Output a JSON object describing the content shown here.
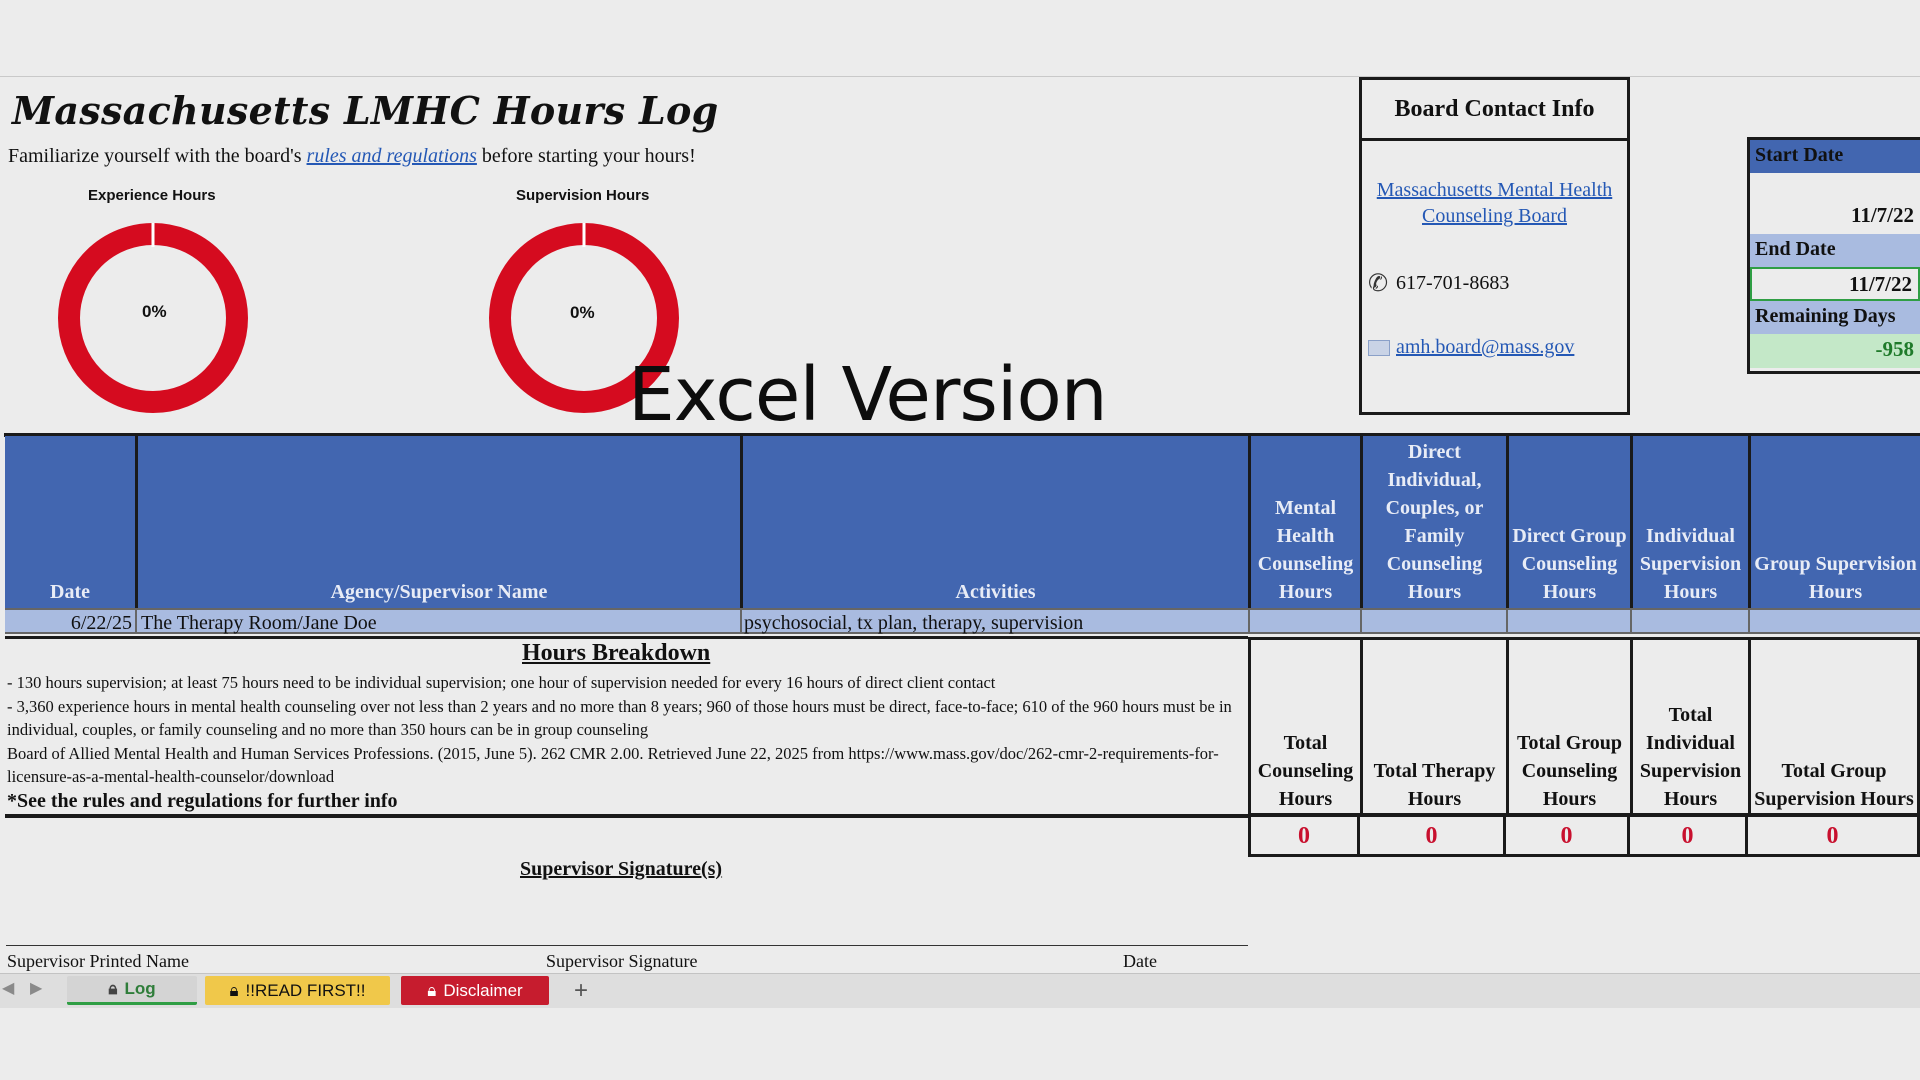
{
  "header": {
    "title": "Massachusetts LMHC Hours Log",
    "subtitle_before": "Familiarize yourself with the board's ",
    "subtitle_link": "rules and regulations",
    "subtitle_after": " before starting your hours!"
  },
  "charts": {
    "experience": {
      "title": "Experience Hours",
      "percent_label": "0%",
      "progress": 0
    },
    "supervision": {
      "title": "Supervision Hours",
      "percent_label": "0%",
      "progress": 0
    }
  },
  "watermark": "Excel Version",
  "contact": {
    "title": "Board Contact Info",
    "board_link": "Massachusetts Mental Health Counseling Board",
    "phone": "617-701-8683",
    "email": "amh.board@mass.gov"
  },
  "dates": {
    "start_label": "Start Date",
    "start_value": "11/7/22",
    "end_label": "End Date",
    "end_value": "11/7/22",
    "remaining_label": "Remaining Days",
    "remaining_value": "-958"
  },
  "table": {
    "columns": [
      "Date",
      "Agency/Supervisor Name",
      "Activities",
      "Mental Health Counseling Hours",
      "Direct Individual, Couples, or Family Counseling Hours",
      "Direct Group Counseling Hours",
      "Individual Supervision Hours",
      "Group Supervision Hours"
    ],
    "rows": [
      {
        "date": "6/22/25",
        "agency": "The Therapy Room/Jane Doe",
        "activities": "psychosocial, tx plan, therapy, supervision"
      }
    ]
  },
  "breakdown": {
    "title": "Hours Breakdown",
    "line1": "- 130 hours supervision; at least 75 hours need to be individual supervision; one hour of supervision needed for every 16 hours of direct client contact",
    "line2": "- 3,360 experience hours in mental health counseling over not less than 2 years and no more than 8 years; 960 of those hours must be direct, face-to-face; 610 of the 960 hours must be in individual, couples, or family counseling and no more than 350 hours can be in group counseling",
    "citation": "Board of Allied Mental Health and Human Services Professions. (2015, June 5). 262 CMR 2.00. Retrieved June 22, 2025 from https://www.mass.gov/doc/262-cmr-2-requirements-for-licensure-as-a-mental-health-counselor/download",
    "note": "*See the rules and regulations for further info"
  },
  "totals": {
    "labels": [
      "Total Counseling Hours",
      "Total Therapy Hours",
      "Total Group Counseling Hours",
      "Total Individual Supervision Hours",
      "Total Group Supervision Hours"
    ],
    "values": [
      "0",
      "0",
      "0",
      "0",
      "0"
    ]
  },
  "signature": {
    "title": "Supervisor Signature(s)",
    "printed_name": "Supervisor Printed Name",
    "signature": "Supervisor Signature",
    "date": "Date"
  },
  "tabs": {
    "log": "Log",
    "read_first": "!!READ FIRST!!",
    "disclaimer": "Disclaimer",
    "add": "+"
  },
  "colors": {
    "header_blue": "#4266b0",
    "row_blue": "#a9bbe0",
    "donut_red": "#d50b1f",
    "total_red": "#c8102e",
    "remaining_green": "#c4e8c8"
  }
}
